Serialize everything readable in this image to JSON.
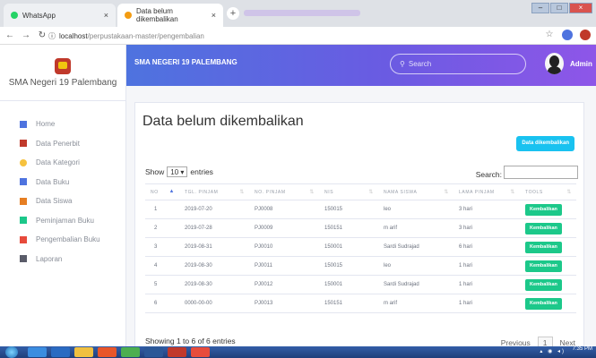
{
  "browser": {
    "tabs": [
      {
        "label": "WhatsApp",
        "active": false
      },
      {
        "label": "Data belum dikembalikan",
        "active": true
      }
    ],
    "new_tab": "+",
    "close_glyph": "×",
    "url_host": "localhost",
    "url_path": "/perpustakaan-master/pengembalian"
  },
  "sidebar": {
    "brand": "SMA Negeri 19 Palembang",
    "items": [
      {
        "label": "Home",
        "icon": "monitor-icon",
        "color": "#4e73df"
      },
      {
        "label": "Data Penerbit",
        "icon": "book-icon",
        "color": "#c0392b"
      },
      {
        "label": "Data Kategori",
        "icon": "dot-icon",
        "color": "#f6c23e"
      },
      {
        "label": "Data Buku",
        "icon": "list-icon",
        "color": "#4e73df"
      },
      {
        "label": "Data Siswa",
        "icon": "user-icon",
        "color": "#e67e22"
      },
      {
        "label": "Peminjaman Buku",
        "icon": "share-icon",
        "color": "#1cc88a"
      },
      {
        "label": "Pengembalian Buku",
        "icon": "return-icon",
        "color": "#e74a3b"
      },
      {
        "label": "Laporan",
        "icon": "report-icon",
        "color": "#5a5c69"
      }
    ]
  },
  "header": {
    "title": "SMA NEGERI 19 PALEMBANG",
    "search_placeholder": "Search",
    "user": "Admin",
    "gradient_start": "#4e73df",
    "gradient_end": "#8e56e8"
  },
  "main": {
    "page_title": "Data belum dikembalikan",
    "top_button": "Data dikembalikan",
    "show_label": "Show",
    "entries_value": "10",
    "entries_label": "entries",
    "search_label": "Search:",
    "columns": [
      "NO",
      "TGL. PINJAM",
      "NO. PINJAM",
      "NIS",
      "NAMA SISWA",
      "LAMA PINJAM",
      "TOOLS"
    ],
    "rows": [
      [
        "1",
        "2019-07-20",
        "PJ0008",
        "150015",
        "leo",
        "3 hari",
        "Kembalikan"
      ],
      [
        "2",
        "2019-07-28",
        "PJ0009",
        "150151",
        "m arif",
        "3 hari",
        "Kembalikan"
      ],
      [
        "3",
        "2019-08-31",
        "PJ0010",
        "150001",
        "Sardi Sudrajad",
        "6 hari",
        "Kembalikan"
      ],
      [
        "4",
        "2019-08-30",
        "PJ0011",
        "150015",
        "leo",
        "1 hari",
        "Kembalikan"
      ],
      [
        "5",
        "2019-08-30",
        "PJ0012",
        "150001",
        "Sardi Sudrajad",
        "1 hari",
        "Kembalikan"
      ],
      [
        "6",
        "0000-00-00",
        "PJ0013",
        "150151",
        "m arif",
        "1 hari",
        "Kembalikan"
      ]
    ],
    "showing": "Showing 1 to 6 of 6 entries",
    "prev": "Previous",
    "page": "1",
    "next": "Next",
    "action_color": "#1cc88a",
    "info_color": "#19c2f0"
  },
  "taskbar": {
    "time": "7:35 PM"
  }
}
